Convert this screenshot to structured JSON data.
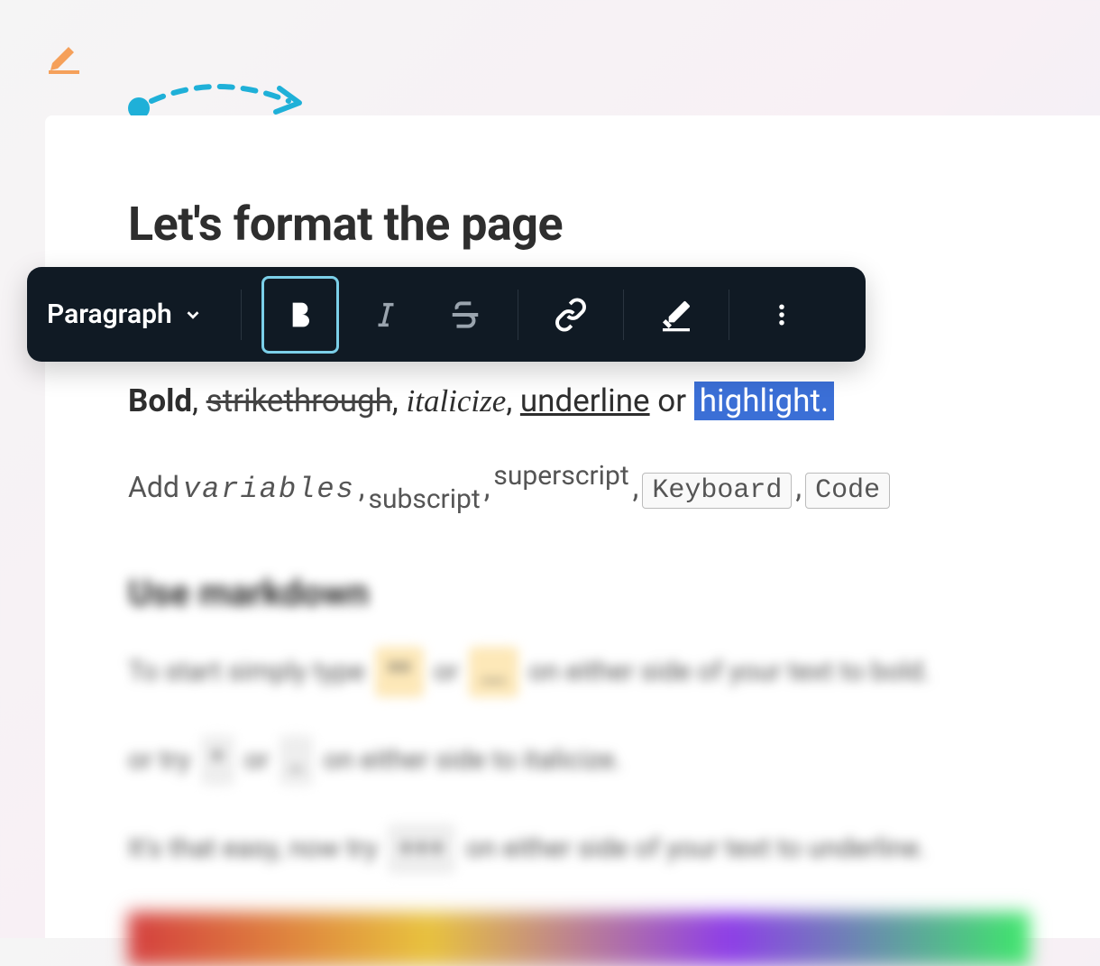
{
  "toolbar": {
    "style_select": "Paragraph",
    "buttons": {
      "bold": "B",
      "italic": "I",
      "strikethrough": "S"
    }
  },
  "page": {
    "title": "Let's format the page",
    "line1": {
      "bold": "Bold",
      "sep1": ", ",
      "strike": "strikethrough",
      "sep2": ", ",
      "italic": "italicize",
      "sep3": ", ",
      "underline": "underline",
      "or": " or ",
      "highlight": "highlight."
    },
    "line2": {
      "add": "Add ",
      "variables": "variables",
      "sep1": " , ",
      "subscript": "subscript",
      "sep2": " , ",
      "superscript": "superscript",
      "sep3": " , ",
      "keyboard": "Keyboard",
      "sep4": " , ",
      "code": "Code"
    },
    "blurred": {
      "heading": "Use markdown",
      "p1a": "To start simply type ",
      "p1chip1": "**",
      "p1b": " or ",
      "p1chip2": "__",
      "p1c": " on either side of your text to bold.",
      "p2a": "or try ",
      "p2chip1": "*",
      "p2b": " or ",
      "p2chip2": "_",
      "p2c": " on either side to italicize.",
      "p3a": "It's that easy, now try ",
      "p3chip1": "+++",
      "p3b": " on either side of your text to underline."
    }
  }
}
